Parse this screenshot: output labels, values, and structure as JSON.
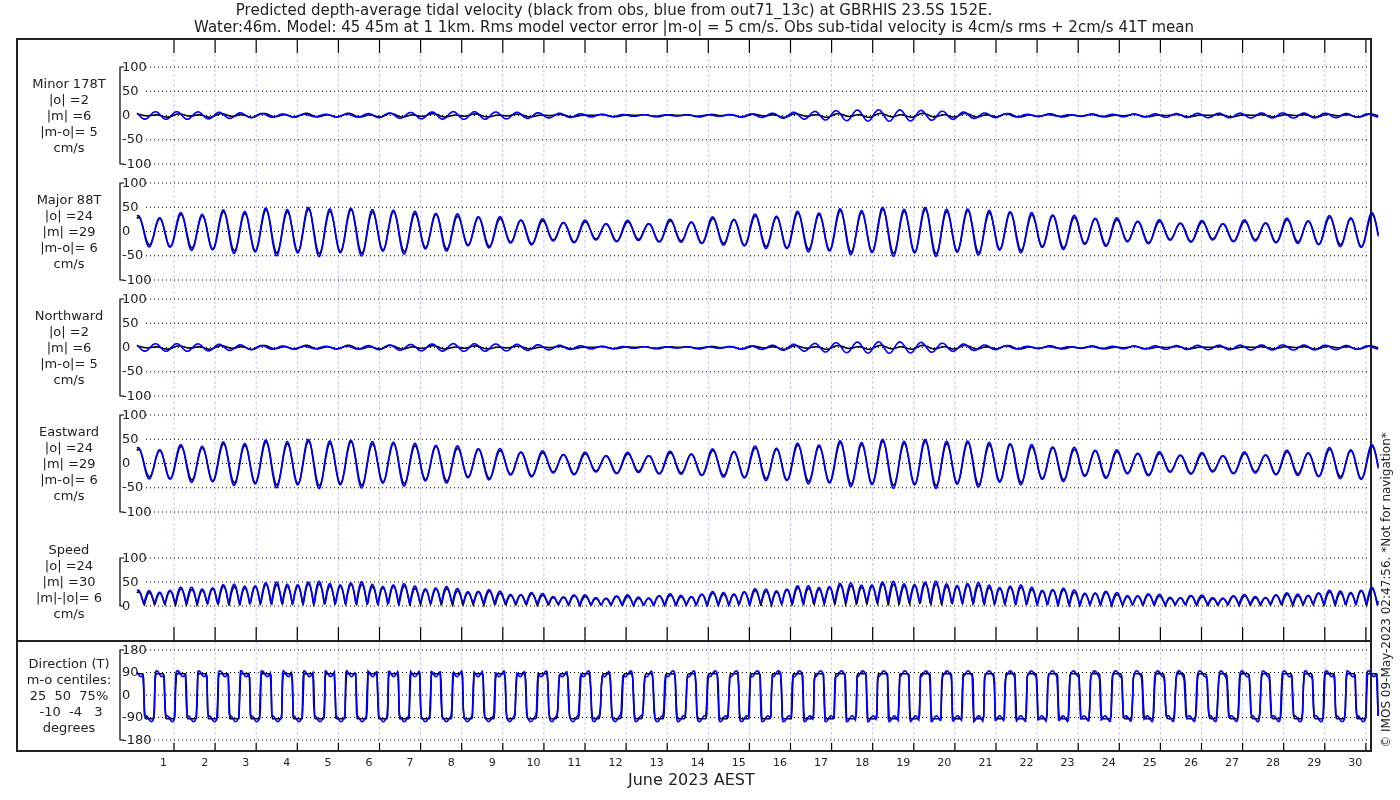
{
  "title": [
    "Predicted depth-average tidal velocity (black from obs, blue from out71_13c) at GBRHIS 23.5S 152E.",
    "Water:46m. Model: 45 45m at 1 1km. Rms model vector error |m-o| = 5 cm/s. Obs sub-tidal velocity is 4cm/s rms + 2cm/s 41T mean"
  ],
  "panels": [
    {
      "kind": "minor",
      "label": [
        "Minor 178T",
        "|o| =2",
        "|m| =6",
        "|m-o|= 5",
        "cm/s"
      ],
      "yticks": [
        "100",
        "50",
        "0",
        "-50",
        "-100"
      ]
    },
    {
      "kind": "major",
      "label": [
        "Major 88T",
        "|o| =24",
        "|m| =29",
        "|m-o|= 6",
        "cm/s"
      ],
      "yticks": [
        "100",
        "50",
        "0",
        "-50",
        "-100"
      ]
    },
    {
      "kind": "north",
      "label": [
        "Northward",
        "|o| =2",
        "|m| =6",
        "|m-o|= 5",
        "cm/s"
      ],
      "yticks": [
        "100",
        "50",
        "0",
        "-50",
        "-100"
      ]
    },
    {
      "kind": "east",
      "label": [
        "Eastward",
        "|o| =24",
        "|m| =29",
        "|m-o|= 6",
        "cm/s"
      ],
      "yticks": [
        "100",
        "50",
        "0",
        "-50",
        "-100"
      ]
    },
    {
      "kind": "speed",
      "label": [
        "Speed",
        "|o| =24",
        "|m| =30",
        "|m|-|o|= 6",
        "cm/s"
      ],
      "yticks": [
        "100",
        "50",
        "0"
      ]
    },
    {
      "kind": "direction",
      "label": [
        "Direction (T)",
        "m-o centiles:",
        "25  50  75%",
        " -10  -4   3",
        "degrees"
      ],
      "yticks": [
        "180",
        "90",
        "0",
        "-90",
        "-180"
      ]
    }
  ],
  "xticks": [
    "1",
    "2",
    "3",
    "4",
    "5",
    "6",
    "7",
    "8",
    "9",
    "10",
    "11",
    "12",
    "13",
    "14",
    "15",
    "16",
    "17",
    "18",
    "19",
    "20",
    "21",
    "22",
    "23",
    "24",
    "25",
    "26",
    "27",
    "28",
    "29",
    "30"
  ],
  "xlabel": "June 2023 AEST",
  "footer": "© IMOS 09-May-2023 02:47:56.  *Not for navigation*"
}
